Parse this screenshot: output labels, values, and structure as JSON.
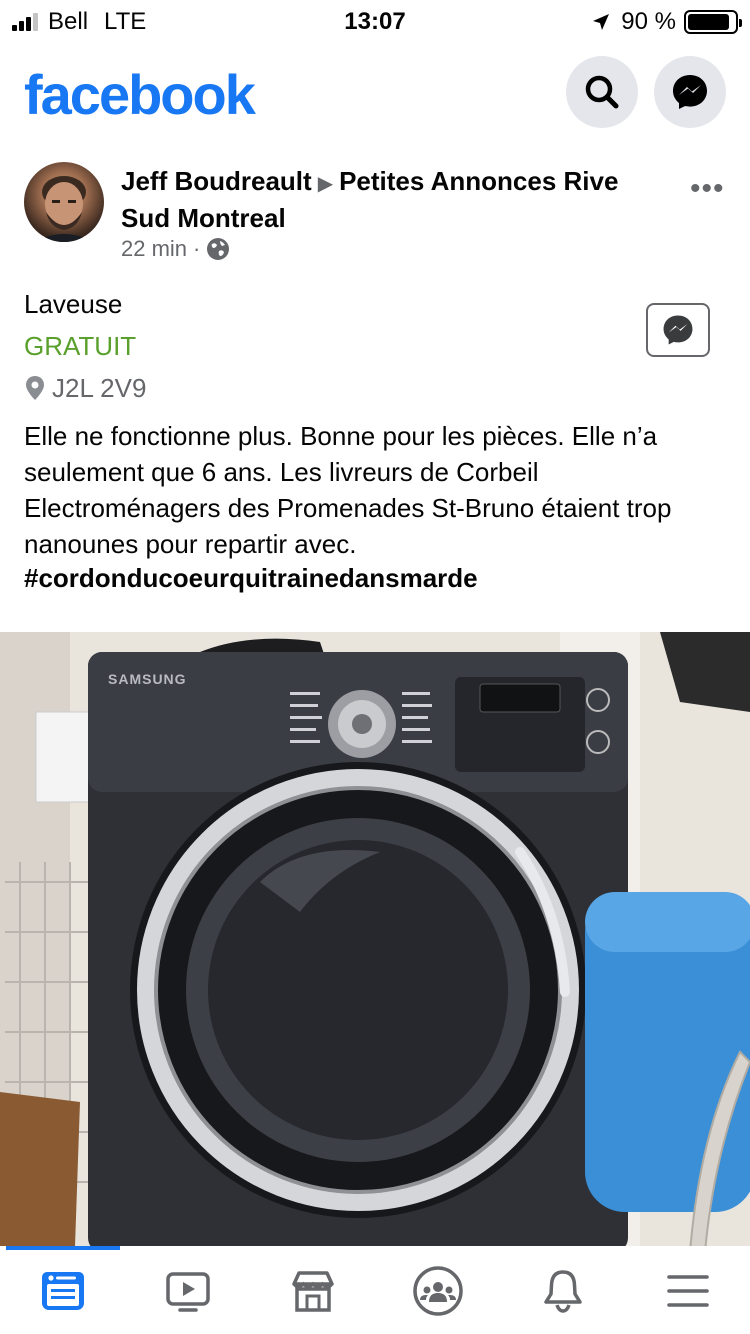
{
  "status_bar": {
    "carrier": "Bell",
    "network": "LTE",
    "time": "13:07",
    "battery": "90 %",
    "battery_level": 0.9,
    "signal_bars": 3,
    "signal_total": 4
  },
  "header": {
    "logo": "facebook",
    "brand_color": "#1877f2",
    "icons": [
      "search-icon",
      "messenger-icon"
    ]
  },
  "post": {
    "author": "Jeff Boudreault",
    "group": "Petites Annonces Rive Sud Montreal",
    "time": "22 min",
    "separator": "·",
    "audience_icon": "globe-icon",
    "menu_icon": "more-options-icon"
  },
  "listing": {
    "title": "Laveuse",
    "price": "GRATUIT",
    "price_color": "#5aa02c",
    "location": "J2L 2V9",
    "description": "Elle ne fonctionne plus. Bonne pour les pièces. Elle n’a seulement que 6 ans. Les livreurs de Corbeil Electroménagers des Promenades St-Bruno étaient trop nanounes pour repartir avec.",
    "hashtag": "#cordonducoeurquitrainedansmarde"
  },
  "photo": {
    "brand_label": "SAMSUNG"
  },
  "tabbar": {
    "tabs": [
      "news-feed-icon",
      "watch-icon",
      "marketplace-icon",
      "groups-icon",
      "notifications-icon",
      "menu-icon"
    ],
    "active": "news-feed-icon"
  }
}
